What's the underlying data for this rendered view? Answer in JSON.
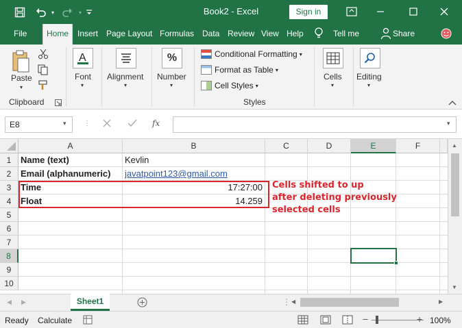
{
  "window": {
    "title": "Book2  -  Excel",
    "signin": "Sign in"
  },
  "tabs": [
    "File",
    "Home",
    "Insert",
    "Page Layout",
    "Formulas",
    "Data",
    "Review",
    "View",
    "Help"
  ],
  "tellme": "Tell me",
  "share": "Share",
  "ribbon": {
    "paste": "Paste",
    "clipboard": "Clipboard",
    "font": "Font",
    "alignment": "Alignment",
    "number": "Number",
    "conditional": "Conditional Formatting",
    "format_table": "Format as Table",
    "cell_styles": "Cell Styles",
    "styles": "Styles",
    "cells": "Cells",
    "editing": "Editing",
    "number_icon": "%"
  },
  "formula_bar": {
    "name_box": "E8",
    "formula": "",
    "fx": "fx"
  },
  "columns": [
    "A",
    "B",
    "C",
    "D",
    "E",
    "F"
  ],
  "rows": [
    "1",
    "2",
    "3",
    "4",
    "5",
    "6",
    "7",
    "8",
    "9",
    "10"
  ],
  "cells": {
    "a1": "Name (text)",
    "b1": "Kevlin",
    "a2": "Email (alphanumeric)",
    "b2": "javatpoint123@gmail.com",
    "a3": "Time",
    "b3": "17:27:00",
    "a4": "Float",
    "b4": "14.259"
  },
  "annotation": {
    "line1": "Cells shifted to up",
    "line2": "after deleting previously",
    "line3": "selected cells"
  },
  "sheet_tab": "Sheet1",
  "status": {
    "ready": "Ready",
    "calculate": "Calculate",
    "zoom": "100%"
  },
  "colors": {
    "excel_green": "#217346",
    "annotation_red": "#d9262c"
  }
}
